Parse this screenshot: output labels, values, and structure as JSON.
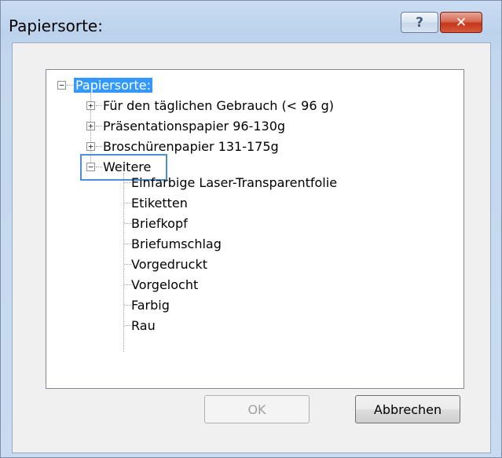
{
  "window": {
    "title": "Papiersorte:",
    "help_label": "?",
    "close_label": "✕"
  },
  "tree": {
    "root": {
      "label": "Papiersorte:",
      "expanded": true,
      "selected": true
    },
    "categories": [
      {
        "label": "Für den täglichen Gebrauch (< 96 g)",
        "expanded": false
      },
      {
        "label": "Präsentationspapier 96-130g",
        "expanded": false
      },
      {
        "label": "Broschürenpapier 131-175g",
        "expanded": false
      },
      {
        "label": "Weitere",
        "expanded": true,
        "focused": true
      }
    ],
    "weitere_items": [
      "Einfarbige Laser-Transparentfolie",
      "Etiketten",
      "Briefkopf",
      "Briefumschlag",
      "Vorgedruckt",
      "Vorgelocht",
      "Farbig",
      "Rau"
    ]
  },
  "buttons": {
    "ok": {
      "label": "OK",
      "enabled": false
    },
    "cancel": {
      "label": "Abbrechen",
      "enabled": true
    }
  },
  "colors": {
    "selection": "#3399ff",
    "focus_outline": "#4a90d9",
    "close_button": "#c4381b"
  }
}
